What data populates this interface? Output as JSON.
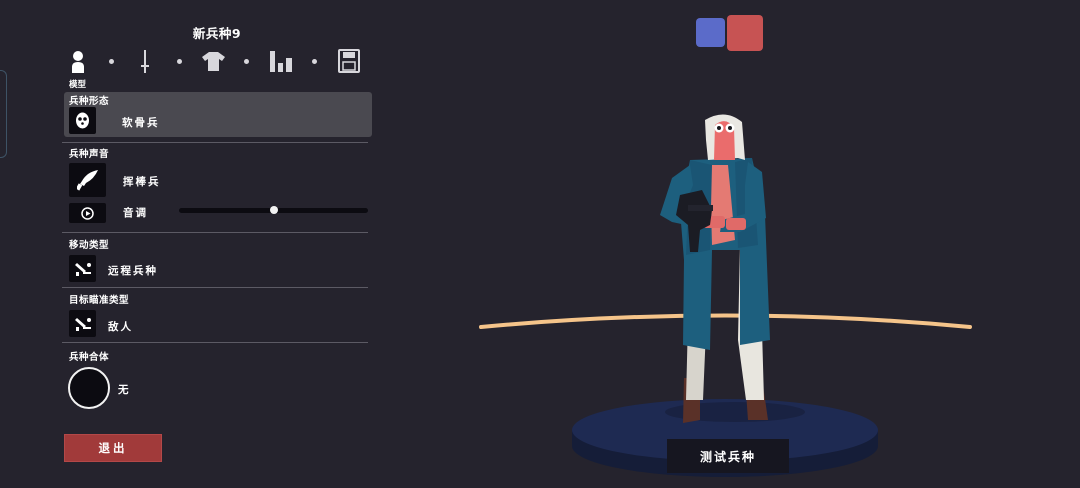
{
  "editor": {
    "title": "新兵种9",
    "nav": {
      "items": [
        {
          "icon": "person-icon",
          "label": "模型"
        },
        {
          "icon": "sword-icon"
        },
        {
          "icon": "shirt-icon"
        },
        {
          "icon": "stats-bars-icon"
        },
        {
          "icon": "floppy-save-icon"
        }
      ],
      "active": 0
    },
    "sections": {
      "unit_form": {
        "label": "兵种形态",
        "value": "软骨兵"
      },
      "unit_voice": {
        "label": "兵种声音",
        "value": "挥棒兵",
        "pitch_label": "音调",
        "pitch_level": 0.5
      },
      "movement": {
        "label": "移动类型",
        "value": "远程兵种"
      },
      "targeting": {
        "label": "目标瞄准类型",
        "value": "敌人"
      },
      "combine": {
        "label": "兵种合体",
        "value": "无"
      }
    },
    "exit_label": "退出"
  },
  "preview": {
    "teams": [
      {
        "name": "blue-team",
        "color": "#5b6bc9"
      },
      {
        "name": "red-team",
        "color": "#c75353",
        "selected": true
      }
    ],
    "test_button": "测试兵种"
  }
}
